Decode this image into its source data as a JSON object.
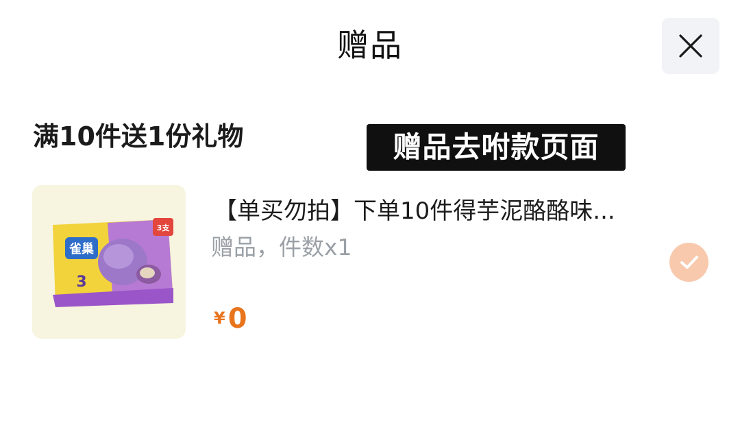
{
  "header": {
    "title": "赠品",
    "close_icon": "close-icon"
  },
  "promo": {
    "rule_text": "满10件送1份礼物"
  },
  "annotation": {
    "text": "赠品去咐款页面"
  },
  "item": {
    "name": "【单买勿拍】下单10件得芋泥酪酪味...",
    "sub": "赠品，件数x1",
    "currency": "¥",
    "price": "0",
    "image_icon": "ice-cream-package-image",
    "image_brand_text": "雀巢",
    "image_badge_text": "3支",
    "selected": true,
    "check_icon": "check-circle-icon"
  },
  "colors": {
    "price": "#e8741c",
    "check_bg": "#f8c9ad",
    "annotation_bg": "#101010",
    "close_bg": "#f1f3f6"
  }
}
